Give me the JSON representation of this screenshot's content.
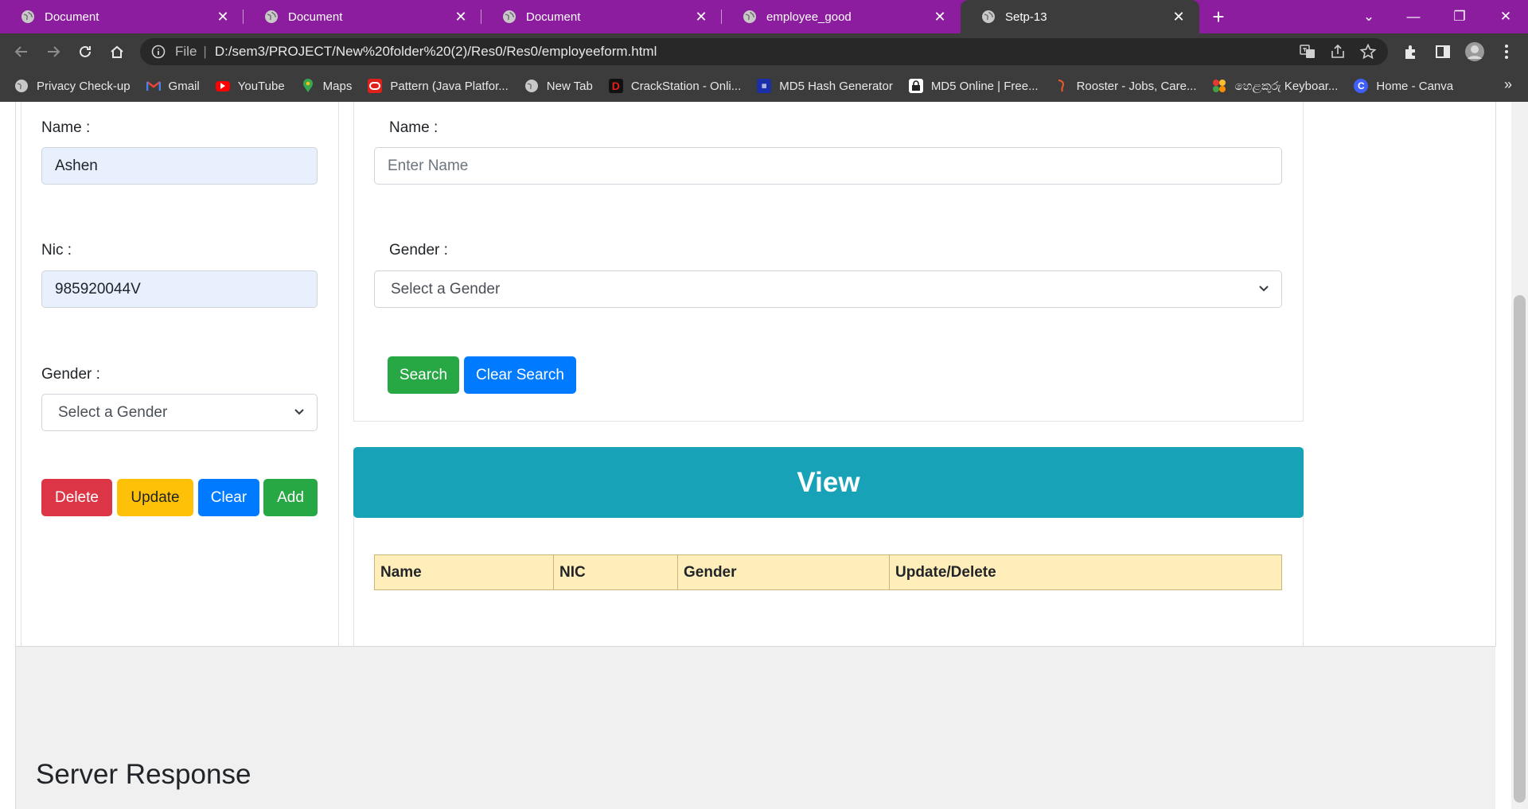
{
  "browser": {
    "tabs": [
      {
        "title": "Document",
        "active": false
      },
      {
        "title": "Document",
        "active": false
      },
      {
        "title": "Document",
        "active": false
      },
      {
        "title": "employee_good",
        "active": false
      },
      {
        "title": "Setp-13",
        "active": true
      }
    ],
    "address": {
      "scheme_label": "File",
      "url": "D:/sem3/PROJECT/New%20folder%20(2)/Res0/Res0/employeeform.html"
    },
    "bookmarks": [
      {
        "label": "Privacy Check-up",
        "icon": "globe-icon"
      },
      {
        "label": "Gmail",
        "icon": "gmail-icon"
      },
      {
        "label": "YouTube",
        "icon": "youtube-icon"
      },
      {
        "label": "Maps",
        "icon": "maps-icon"
      },
      {
        "label": "Pattern (Java Platfor...",
        "icon": "oracle-icon"
      },
      {
        "label": "New Tab",
        "icon": "globe-icon"
      },
      {
        "label": "CrackStation - Onli...",
        "icon": "crackstation-icon"
      },
      {
        "label": "MD5 Hash Generator",
        "icon": "md5-icon"
      },
      {
        "label": "MD5 Online | Free...",
        "icon": "lock-icon"
      },
      {
        "label": "Rooster - Jobs, Care...",
        "icon": "rooster-icon"
      },
      {
        "label": "හෙළකුරු Keyboar...",
        "icon": "helakuru-icon"
      },
      {
        "label": "Home - Canva",
        "icon": "canva-icon"
      }
    ],
    "bookmarks_more": "»"
  },
  "form": {
    "name_label": "Name :",
    "name_value": "Ashen",
    "nic_label": "Nic :",
    "nic_value": "985920044V",
    "gender_label": "Gender :",
    "gender_value": "Select a Gender",
    "buttons": {
      "delete": "Delete",
      "update": "Update",
      "clear": "Clear",
      "add": "Add"
    }
  },
  "search": {
    "name_label": "Name :",
    "name_placeholder": "Enter Name",
    "gender_label": "Gender :",
    "gender_value": "Select a Gender",
    "search_button": "Search",
    "clear_button": "Clear Search"
  },
  "view": {
    "title": "View",
    "columns": [
      "Name",
      "NIC",
      "Gender",
      "Update/Delete"
    ]
  },
  "server": {
    "title": "Server Response"
  },
  "colors": {
    "tab_bar": "#8b1d9e",
    "chrome": "#3c3c3c",
    "danger": "#dc3545",
    "warning": "#ffc107",
    "primary": "#007bff",
    "success": "#28a745",
    "info": "#17a2b8",
    "table_header": "#ffeeba"
  }
}
